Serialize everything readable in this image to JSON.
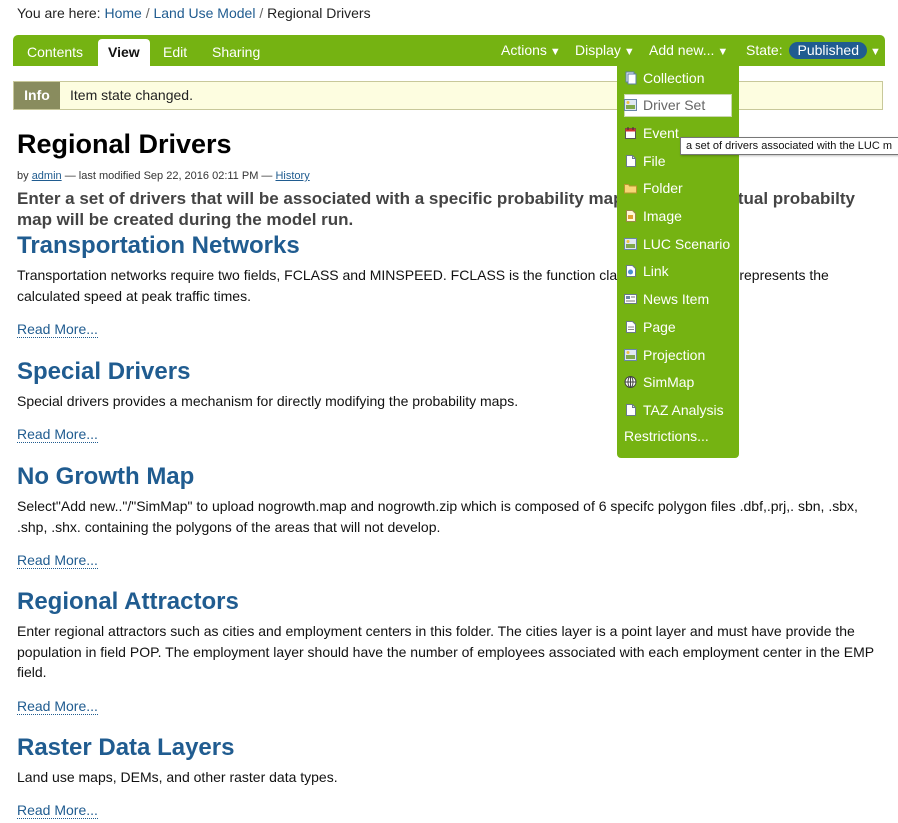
{
  "breadcrumb": {
    "prefix": "You are here:",
    "items": [
      "Home",
      "Land Use Model",
      "Regional Drivers"
    ],
    "separator": "/"
  },
  "toolbar": {
    "tabs": [
      "Contents",
      "View",
      "Edit",
      "Sharing"
    ],
    "active_tab": "View",
    "menus": {
      "actions": "Actions",
      "display": "Display",
      "add_new": "Add new...",
      "state_label": "State:",
      "state_value": "Published"
    },
    "caret": "▼"
  },
  "info": {
    "label": "Info",
    "message": "Item state changed."
  },
  "page": {
    "title": "Regional Drivers",
    "byline": {
      "by": "by",
      "author": "admin",
      "modified": "— last modified Sep 22, 2016 02:11 PM —",
      "history": "History"
    },
    "description": "Enter a set of drivers that will be associated with a specific probability map folder. The actual probabilty map will be created during the model run."
  },
  "sections": [
    {
      "title": "Transportation Networks",
      "text": "Transportation networks require two fields, FCLASS and MINSPEED. FCLASS is the function class and MINSPEED represents the calculated speed at peak traffic times.",
      "read_more": "Read More..."
    },
    {
      "title": "Special Drivers",
      "text": "Special drivers provides a mechanism for directly modifying the probability maps.",
      "read_more": "Read More..."
    },
    {
      "title": "No Growth Map",
      "text": "Select\"Add new..\"/\"SimMap\" to upload nogrowth.map and nogrowth.zip which is composed of 6 specifc polygon files .dbf,.prj,. sbn, .sbx, .shp, .shx. containing the polygons of the areas that will not develop.",
      "read_more": "Read More..."
    },
    {
      "title": "Regional Attractors",
      "text": "Enter regional attractors such as cities and employment centers in this folder. The cities layer is a point layer and must have provide the population in field POP. The employment layer should have the number of employees associated with each employment center in the EMP field.",
      "read_more": "Read More..."
    },
    {
      "title": "Raster Data Layers",
      "text": "Land use maps, DEMs, and other raster data types.",
      "read_more": "Read More..."
    }
  ],
  "add_new_menu": {
    "items": [
      {
        "label": "Collection",
        "icon": "collection-icon"
      },
      {
        "label": "Driver Set",
        "icon": "driver-set-icon"
      },
      {
        "label": "Event",
        "icon": "event-icon"
      },
      {
        "label": "File",
        "icon": "file-icon"
      },
      {
        "label": "Folder",
        "icon": "folder-icon"
      },
      {
        "label": "Image",
        "icon": "image-icon"
      },
      {
        "label": "LUC Scenario",
        "icon": "luc-scenario-icon"
      },
      {
        "label": "Link",
        "icon": "link-icon"
      },
      {
        "label": "News Item",
        "icon": "news-item-icon"
      },
      {
        "label": "Page",
        "icon": "page-icon"
      },
      {
        "label": "Projection",
        "icon": "projection-icon"
      },
      {
        "label": "SimMap",
        "icon": "simmap-icon"
      },
      {
        "label": "TAZ Analysis",
        "icon": "taz-analysis-icon"
      }
    ],
    "restrictions": "Restrictions...",
    "hovered": "Driver Set"
  },
  "tooltip": "a set of drivers associated with the LUC m",
  "colors": {
    "toolbar_green": "#75b312",
    "link_blue": "#205c90",
    "info_label": "#898c5e",
    "info_bg": "#fdfde0"
  }
}
